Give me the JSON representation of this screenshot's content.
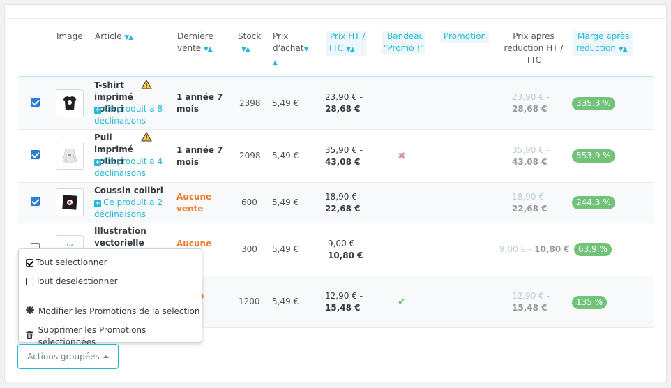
{
  "headers": {
    "image": "Image",
    "article": "Article",
    "derniere_1": "Dernière",
    "derniere_2": "vente",
    "stock": "Stock",
    "prix_achat_1": "Prix",
    "prix_achat_2": "d'achat",
    "prix_ht_1": "Prix HT /",
    "prix_ht_2": "TTC",
    "bandeau_1": "Bandeau",
    "bandeau_2": "\"Promo !\"",
    "promotion": "Promotion",
    "prix_apres_1": "Prix apres",
    "prix_apres_2": "reduction HT /",
    "prix_apres_3": "TTC",
    "marge_1": "Marge après",
    "marge_2": "reduction",
    "sort_arrows": "▼▲"
  },
  "rows": [
    {
      "checked": true,
      "name_1": "T-shirt",
      "name_2": "imprimé colibri",
      "declinaisons_1": "Ce produit a 8",
      "declinaisons_2": "declinaisons",
      "last_sale_1": "1 année 7",
      "last_sale_2": "mois",
      "stock": "2398",
      "prix_achat": "5,49 €",
      "prix_ht": "23,90 € -",
      "prix_ttc": "28,68 €",
      "bandeau": "",
      "reduc_ht": "23,90 € -",
      "reduc_ttc": "28,68 €",
      "marge": "335.3 %"
    },
    {
      "checked": true,
      "name_1": "Pull",
      "name_2": "imprimé colibri",
      "declinaisons_1": "Ce produit a 4",
      "declinaisons_2": "declinaisons",
      "last_sale_1": "1 année 7",
      "last_sale_2": "mois",
      "stock": "2098",
      "prix_achat": "5,49 €",
      "prix_ht": "35,90 € -",
      "prix_ttc": "43,08 €",
      "bandeau": "✖",
      "reduc_ht": "35,90 € -",
      "reduc_ttc": "43,08 €",
      "marge": "553.9 %"
    },
    {
      "checked": true,
      "name_1": "Coussin colibri",
      "declinaisons_1": "Ce produit a 2",
      "declinaisons_2": "declinaisons",
      "last_sale_1": "Aucune",
      "last_sale_2": "vente",
      "stock": "600",
      "prix_achat": "5,49 €",
      "prix_ht": "18,90 € -",
      "prix_ttc": "22,68 €",
      "bandeau": "",
      "reduc_ht": "18,90 € -",
      "reduc_ttc": "22,68 €",
      "marge": "244.3 %"
    },
    {
      "checked": false,
      "name_1": "Illustration",
      "name_2": "vectorielle",
      "last_sale_1": "Aucune",
      "stock": "300",
      "prix_achat": "5,49 €",
      "prix_ht": "9,00 € -",
      "prix_ttc": "10,80 €",
      "bandeau": "",
      "reduc_ht": "9,00 € -",
      "reduc_ttc": "10,80 €",
      "marge": "63.9 %"
    },
    {
      "checked": false,
      "last_sale_1": "e",
      "stock": "1200",
      "prix_achat": "5,49 €",
      "prix_ht": "12,90 € -",
      "prix_ttc": "15,48 €",
      "bandeau": "✔",
      "reduc_ht": "12,90 € -",
      "reduc_ttc": "15,48 €",
      "marge": "135 %"
    }
  ],
  "dropdown": {
    "select_all": "Tout selectionner",
    "deselect_all": "Tout deselectionner",
    "modify_promos": "Modifier les Promotions de la selection",
    "delete_promos": "Supprimer les Promotions sélectionnées"
  },
  "actions_button": "Actions groupées",
  "colors": {
    "accent": "#25b9d7",
    "success": "#72c279",
    "warning": "#f07c2b",
    "danger": "#e08f95"
  }
}
